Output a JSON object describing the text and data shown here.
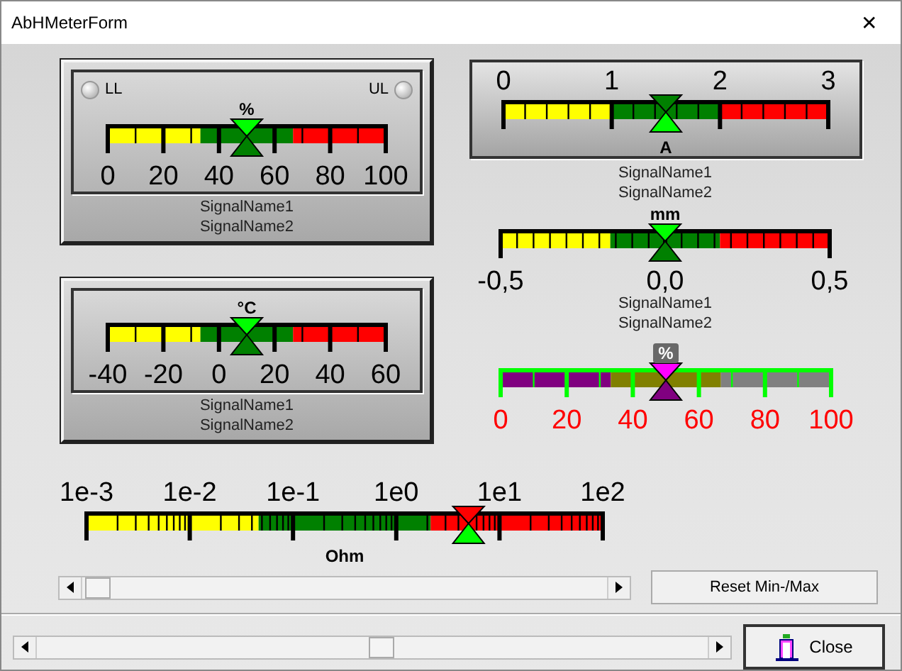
{
  "window": {
    "title": "AbHMeterForm",
    "close": "✕"
  },
  "meters": [
    {
      "kind": "panel",
      "leds": [
        {
          "label": "LL",
          "on": false
        },
        {
          "label": "UL",
          "on": false
        }
      ],
      "unit": "%",
      "scale": [
        "0",
        "20",
        "40",
        "60",
        "80",
        "100"
      ],
      "zones": [
        {
          "color": "#ffff00"
        },
        {
          "color": "#008000"
        },
        {
          "color": "#ff0000"
        }
      ],
      "level": 0.5,
      "signal_names": [
        "SignalName1",
        "SignalName2"
      ]
    },
    {
      "kind": "panel",
      "unit": "°C",
      "scale": [
        "-40",
        "-20",
        "0",
        "20",
        "40",
        "60"
      ],
      "zones": [
        {
          "color": "#ffff00"
        },
        {
          "color": "#008000"
        },
        {
          "color": "#ff0000"
        }
      ],
      "level": 0.5,
      "signal_names": [
        "SignalName1",
        "SignalName2"
      ]
    },
    {
      "kind": "framed",
      "unit": "A",
      "scale": [
        "0",
        "1",
        "2",
        "3"
      ],
      "zones": [
        {
          "color": "#ffff00"
        },
        {
          "color": "#008000"
        },
        {
          "color": "#ff0000"
        }
      ],
      "level": 0.5,
      "signal_names": [
        "SignalName1",
        "SignalName2"
      ]
    },
    {
      "kind": "plain",
      "unit": "mm",
      "scale": [
        "-0,5",
        "0,0",
        "0,5"
      ],
      "zones": [
        {
          "color": "#ffff00"
        },
        {
          "color": "#008000"
        },
        {
          "color": "#ff0000"
        }
      ],
      "level": 0.5,
      "signal_names": [
        "SignalName1",
        "SignalName2"
      ]
    },
    {
      "kind": "colored",
      "unit": "%",
      "scale": [
        "0",
        "20",
        "40",
        "60",
        "80",
        "100"
      ],
      "zones": [
        {
          "color": "#800080"
        },
        {
          "color": "#808000"
        },
        {
          "color": "#808080"
        }
      ],
      "level": 0.5
    },
    {
      "kind": "log",
      "unit": "Ohm",
      "scale": [
        "1e-3",
        "1e-2",
        "1e-1",
        "1e0",
        "1e1",
        "1e2"
      ],
      "zones": [
        {
          "color": "#ffff00"
        },
        {
          "color": "#008000"
        },
        {
          "color": "#ff0000"
        }
      ],
      "level": 0.74
    }
  ],
  "buttons": {
    "reset": "Reset Min-/Max",
    "close": "Close"
  }
}
